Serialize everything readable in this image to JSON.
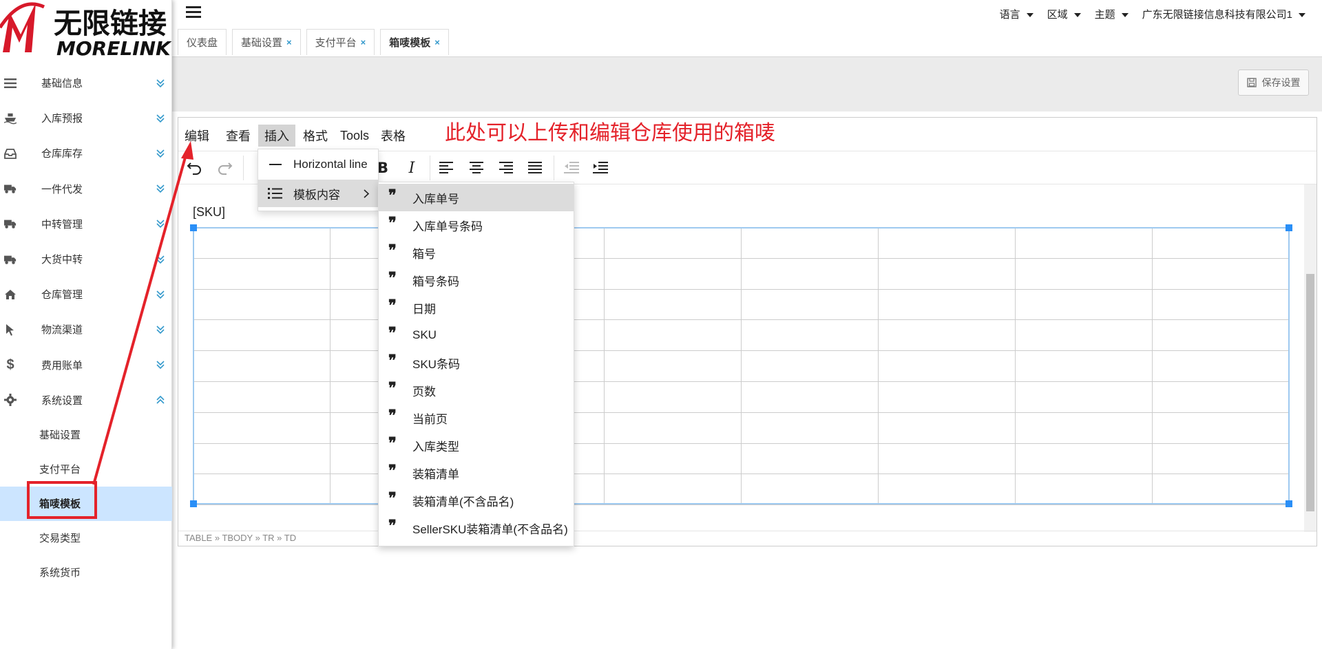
{
  "brand": {
    "name_cn": "无限链接",
    "name_en": "MORELINK"
  },
  "sidebar": {
    "items": [
      {
        "label": "基础信息",
        "icon": "list-icon"
      },
      {
        "label": "入库预报",
        "icon": "ship-icon"
      },
      {
        "label": "仓库库存",
        "icon": "inbox-icon"
      },
      {
        "label": "一件代发",
        "icon": "truck-icon"
      },
      {
        "label": "中转管理",
        "icon": "truck-icon"
      },
      {
        "label": "大货中转",
        "icon": "truck-icon"
      },
      {
        "label": "仓库管理",
        "icon": "home-icon"
      },
      {
        "label": "物流渠道",
        "icon": "cursor-icon"
      },
      {
        "label": "费用账单",
        "icon": "dollar-icon"
      },
      {
        "label": "系统设置",
        "icon": "gear-icon"
      }
    ],
    "sub_items": [
      {
        "label": "基础设置"
      },
      {
        "label": "支付平台"
      },
      {
        "label": "箱唛模板",
        "active": true
      },
      {
        "label": "交易类型"
      },
      {
        "label": "系统货币"
      }
    ]
  },
  "topbar": {
    "language": "语言",
    "region": "区域",
    "theme": "主题",
    "company": "广东无限链接信息科技有限公司1"
  },
  "tabs": [
    {
      "label": "仪表盘",
      "closable": false
    },
    {
      "label": "基础设置",
      "closable": true
    },
    {
      "label": "支付平台",
      "closable": true
    },
    {
      "label": "箱唛模板",
      "closable": true,
      "active": true
    }
  ],
  "save_button": "保存设置",
  "editor": {
    "menus": [
      "编辑",
      "查看",
      "插入",
      "格式",
      "Tools",
      "表格"
    ],
    "active_menu": "插入",
    "content_text": "[SKU]",
    "statusbar": "TABLE » TBODY » TR » TD",
    "insert_menu": [
      {
        "label": "Horizontal line",
        "icon": "horizontal-line-icon"
      },
      {
        "label": "模板内容",
        "icon": "list-icon",
        "submenu": true
      }
    ],
    "template_items": [
      "入库单号",
      "入库单号条码",
      "箱号",
      "箱号条码",
      "日期",
      "SKU",
      "SKU条码",
      "页数",
      "当前页",
      "入库类型",
      "装箱清单",
      "装箱清单(不含品名)",
      "SellerSKU装箱清单(不含品名)"
    ],
    "table_rows": 9,
    "table_cols": 8
  },
  "annotation": "此处可以上传和编辑仓库使用的箱唛",
  "colors": {
    "accent": "#3399cc",
    "highlight": "#cce5ff",
    "annotation": "#e4222a",
    "selection": "#2a8ff7"
  }
}
